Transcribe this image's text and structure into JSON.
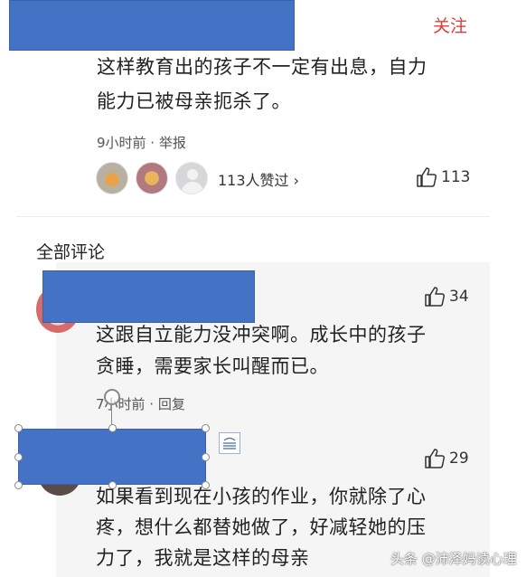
{
  "top_comment": {
    "follow_label": "关注",
    "text_line1": "这样教育出的孩子不一定有出息，自力",
    "text_line2": "能力已被母亲扼杀了。",
    "meta": "9小时前 · 举报",
    "liked_by_text": "113人赞过 ›",
    "like_count": "113"
  },
  "all_comments_title": "全部评论",
  "comment1": {
    "like_count": "34",
    "text_line1": "这跟自立能力没冲突啊。成长中的孩子",
    "text_line2": "贪睡，需要家长叫醒而已。",
    "meta": "7小时前 · 回复"
  },
  "comment2": {
    "like_count": "29",
    "text_line1": "如果看到现在小孩的作业，你就除了心",
    "text_line2": "疼，想什么都替她做了，好减轻她的压",
    "text_line3": "力了，我就是这样的母亲"
  },
  "watermark": "头条 @沛泽妈读心理",
  "colors": {
    "redact": "#4472c4",
    "follow": "#e03a3a"
  }
}
